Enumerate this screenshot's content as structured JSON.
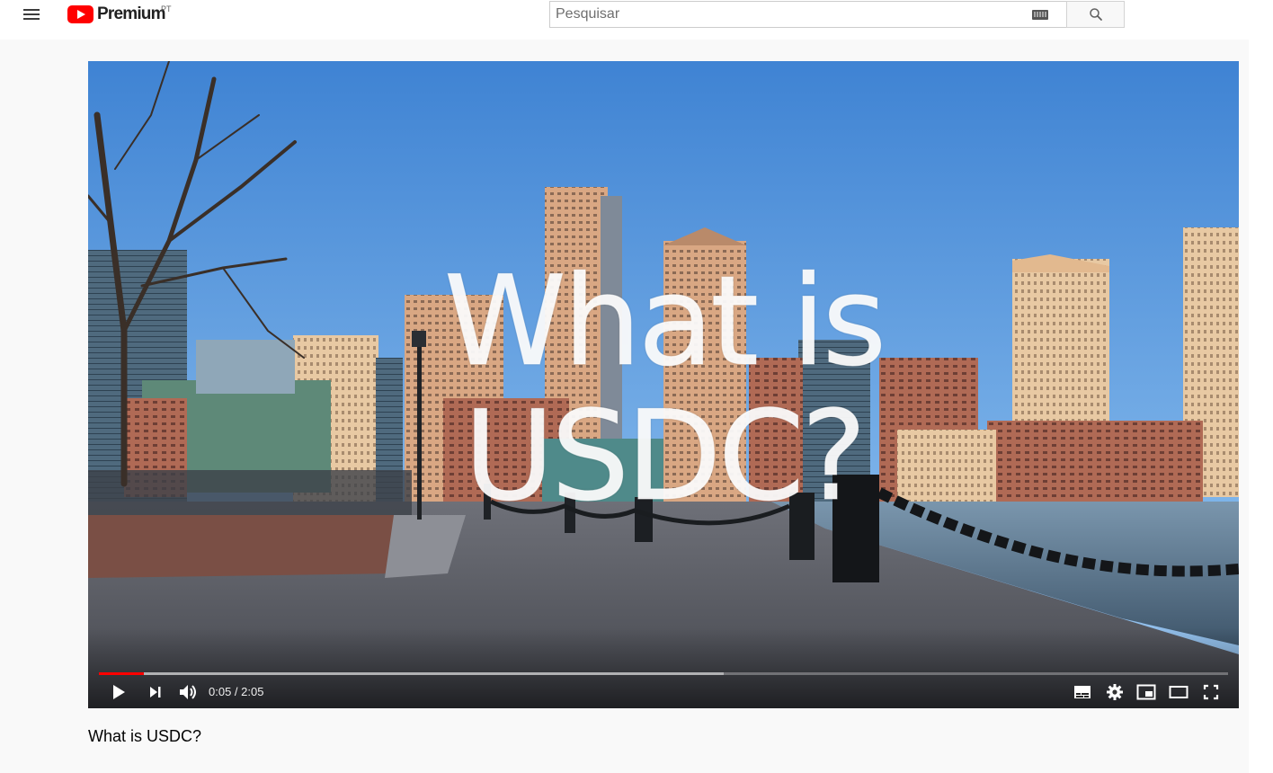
{
  "masthead": {
    "brand": "Premium",
    "country_code": "PT",
    "search": {
      "placeholder": "Pesquisar",
      "value": ""
    }
  },
  "player": {
    "overlay_title_line1": "What is",
    "overlay_title_line2": "USDC?",
    "time": {
      "current": "0:05",
      "duration": "2:05",
      "separator": " / "
    },
    "progress": {
      "played_fraction": 0.04,
      "buffered_fraction": 0.553
    }
  },
  "video": {
    "title": "What is USDC?"
  },
  "colors": {
    "accent": "#ff0000",
    "icon": "#ffffff"
  },
  "icons": [
    "menu-icon",
    "youtube-logo-icon",
    "keyboard-icon",
    "search-icon",
    "play-icon",
    "next-icon",
    "volume-icon",
    "subtitles-icon",
    "settings-icon",
    "miniplayer-icon",
    "theater-icon",
    "fullscreen-icon"
  ]
}
